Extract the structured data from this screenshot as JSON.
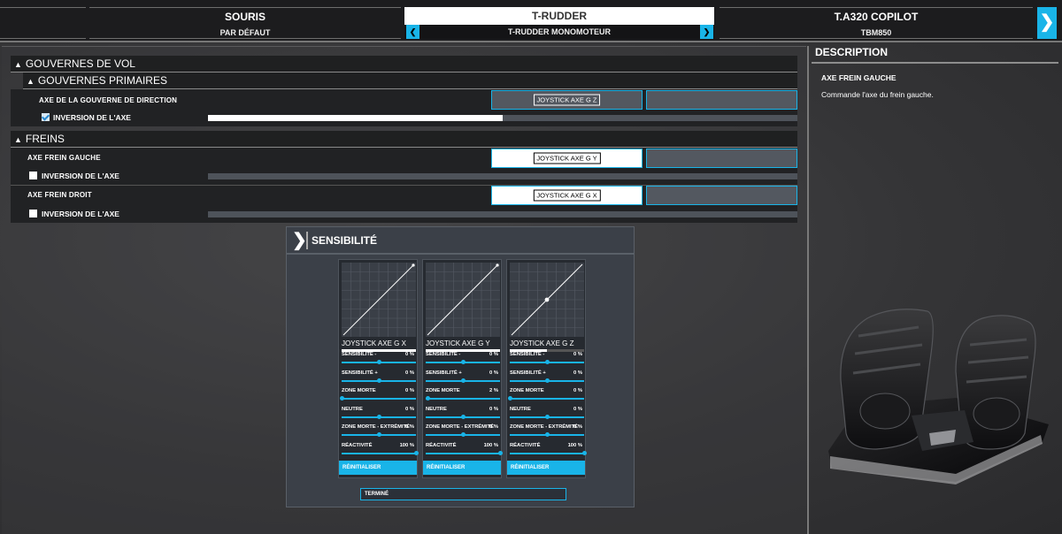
{
  "devices": [
    {
      "name": "SOURIS",
      "preset": "PAR DÉFAUT"
    },
    {
      "name": "T-RUDDER",
      "preset": "T-RUDDER MONOMOTEUR"
    },
    {
      "name": "T.A320 COPILOT",
      "preset": "TBM850"
    }
  ],
  "nav": {
    "prev_icon": "chevron-left-icon",
    "next_icon": "chevron-right-icon"
  },
  "sections": {
    "flight_controls": "GOUVERNES DE VOL",
    "primary_controls": "GOUVERNES PRIMAIRES",
    "brakes": "FREINS"
  },
  "bindings": {
    "rudder": {
      "label": "AXE DE LA GOUVERNE DE DIRECTION",
      "key": "JOYSTICK AXE G Z",
      "invert_label": "INVERSION DE L'AXE",
      "inverted": true,
      "axis_level": 0.5
    },
    "left_brake": {
      "label": "AXE FREIN GAUCHE",
      "key": "JOYSTICK AXE G Y",
      "invert_label": "INVERSION DE L'AXE",
      "inverted": false,
      "axis_level": 0
    },
    "right_brake": {
      "label": "AXE FREIN DROIT",
      "key": "JOYSTICK AXE G X",
      "invert_label": "INVERSION DE L'AXE",
      "inverted": false,
      "axis_level": 0
    }
  },
  "sensitivity": {
    "title": "SENSIBILITÉ",
    "reset_label": "RÉINITIALISER",
    "done_label": "TERMINÉ",
    "param_labels": [
      "SENSIBILITÉ -",
      "SENSIBILITÉ +",
      "ZONE MORTE",
      "NEUTRE",
      "ZONE MORTE - EXTRÉMITÉ",
      "RÉACTIVITÉ"
    ],
    "axes": [
      {
        "name": "JOYSTICK AXE G X",
        "input_level": 1.0,
        "curve_dot": "end",
        "values": [
          "0 %",
          "0 %",
          "0 %",
          "0 %",
          "0 %",
          "100 %"
        ],
        "positions": [
          0.5,
          0.5,
          0.0,
          0.5,
          0.5,
          1.0
        ]
      },
      {
        "name": "JOYSTICK AXE G Y",
        "input_level": 1.0,
        "curve_dot": "end",
        "values": [
          "0 %",
          "0 %",
          "2 %",
          "0 %",
          "0 %",
          "100 %"
        ],
        "positions": [
          0.5,
          0.5,
          0.02,
          0.5,
          0.5,
          1.0
        ]
      },
      {
        "name": "JOYSTICK AXE G Z",
        "input_level": 0.5,
        "curve_dot": "mid",
        "values": [
          "0 %",
          "0 %",
          "0 %",
          "0 %",
          "0 %",
          "100 %"
        ],
        "positions": [
          0.5,
          0.5,
          0.0,
          0.5,
          0.5,
          1.0
        ]
      }
    ]
  },
  "description": {
    "title": "DESCRIPTION",
    "subtitle": "AXE FREIN GAUCHE",
    "text": "Commande l'axe du frein gauche."
  },
  "colors": {
    "accent": "#19b4e8",
    "panel": "#212224",
    "bar": "#4e535a"
  }
}
